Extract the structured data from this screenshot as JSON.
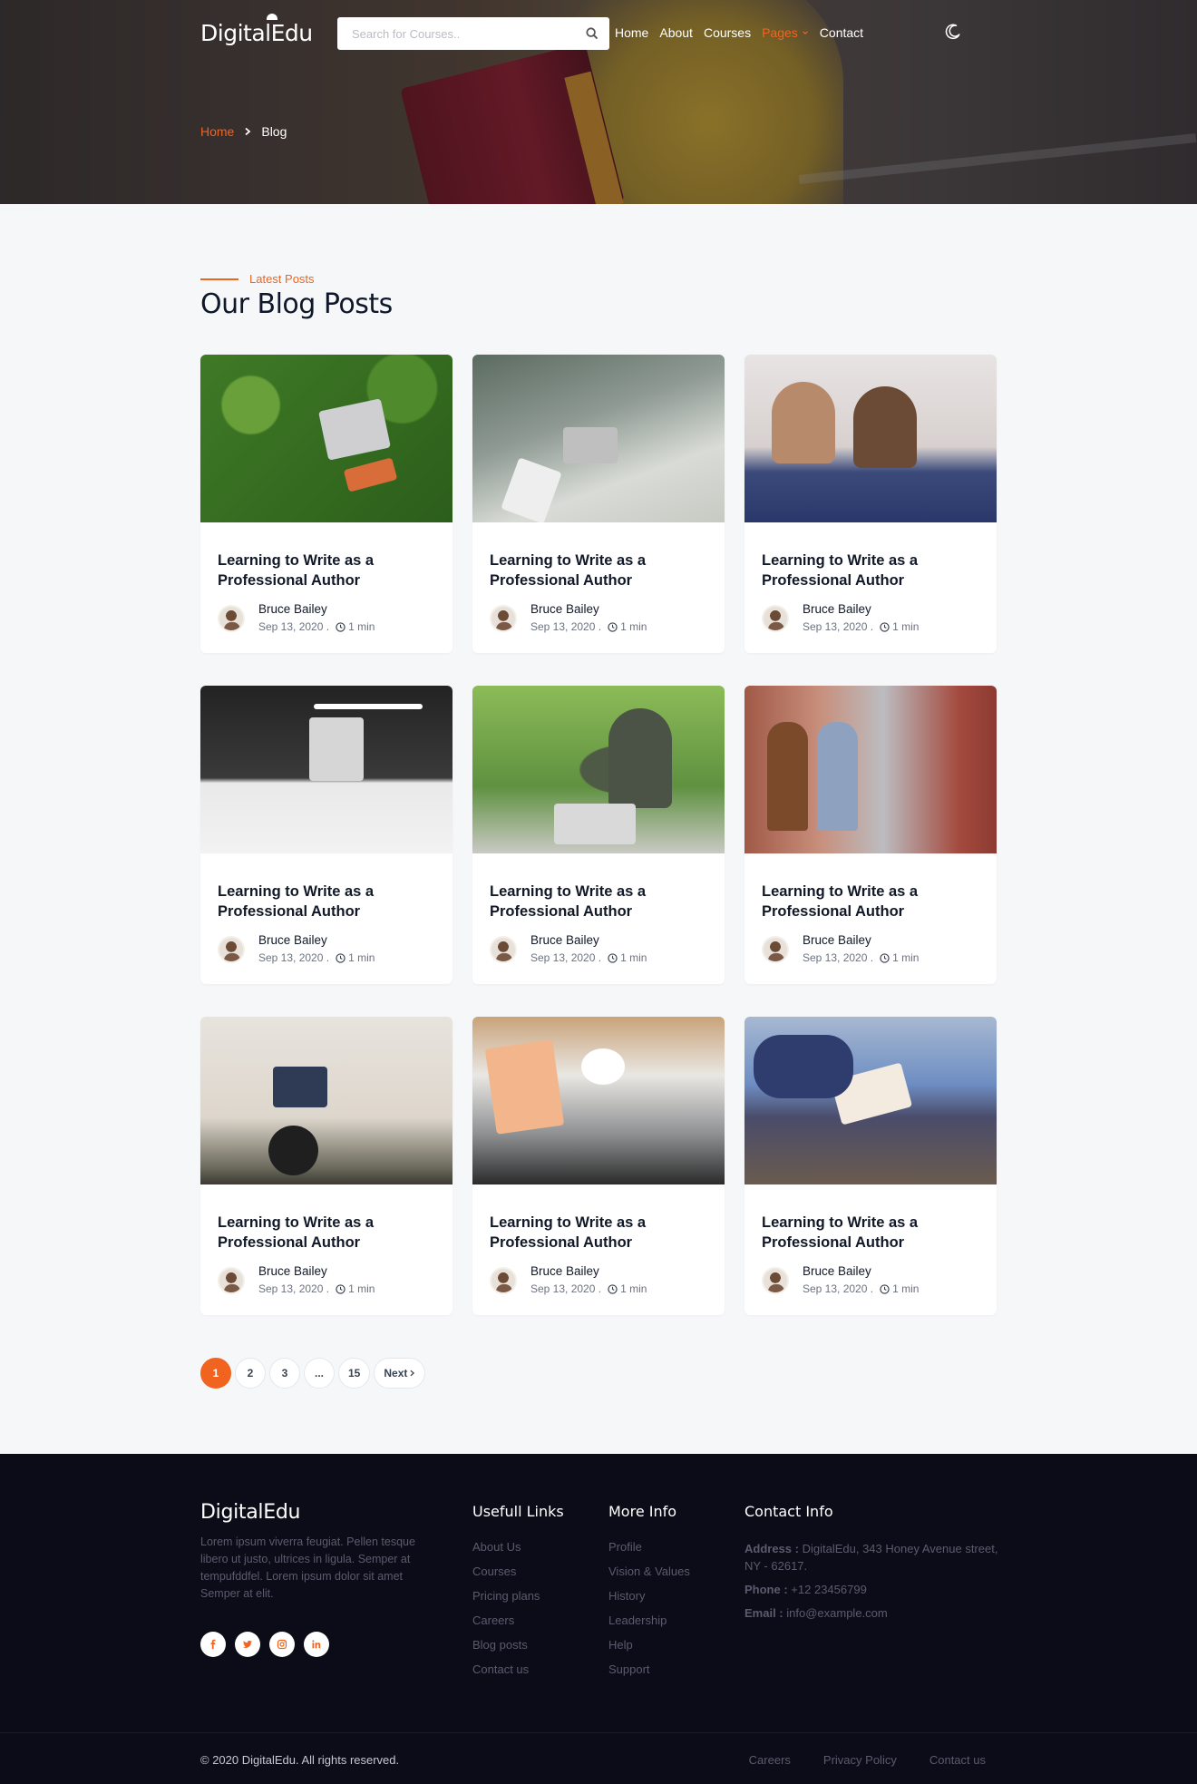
{
  "header": {
    "logo": "DigitalEdu",
    "search_placeholder": "Search for Courses..",
    "nav": [
      {
        "label": "Home",
        "active": false
      },
      {
        "label": "About",
        "active": false
      },
      {
        "label": "Courses",
        "active": false
      },
      {
        "label": "Pages",
        "active": true,
        "has_dropdown": true
      },
      {
        "label": "Contact",
        "active": false
      }
    ],
    "theme_toggle_icon": "moon-icon",
    "accent_color": "#f0641f"
  },
  "breadcrumb": {
    "home": "Home",
    "current": "Blog"
  },
  "section": {
    "kicker": "Latest Posts",
    "title": "Our Blog Posts"
  },
  "posts": [
    {
      "title": "Learning to Write as a Professional Author",
      "author": "Bruce Bailey",
      "date": "Sep 13, 2020 .",
      "read_time": "1 min"
    },
    {
      "title": "Learning to Write as a Professional Author",
      "author": "Bruce Bailey",
      "date": "Sep 13, 2020 .",
      "read_time": "1 min"
    },
    {
      "title": "Learning to Write as a Professional Author",
      "author": "Bruce Bailey",
      "date": "Sep 13, 2020 .",
      "read_time": "1 min"
    },
    {
      "title": "Learning to Write as a Professional Author",
      "author": "Bruce Bailey",
      "date": "Sep 13, 2020 .",
      "read_time": "1 min"
    },
    {
      "title": "Learning to Write as a Professional Author",
      "author": "Bruce Bailey",
      "date": "Sep 13, 2020 .",
      "read_time": "1 min"
    },
    {
      "title": "Learning to Write as a Professional Author",
      "author": "Bruce Bailey",
      "date": "Sep 13, 2020 .",
      "read_time": "1 min"
    },
    {
      "title": "Learning to Write as a Professional Author",
      "author": "Bruce Bailey",
      "date": "Sep 13, 2020 .",
      "read_time": "1 min"
    },
    {
      "title": "Learning to Write as a Professional Author",
      "author": "Bruce Bailey",
      "date": "Sep 13, 2020 .",
      "read_time": "1 min"
    },
    {
      "title": "Learning to Write as a Professional Author",
      "author": "Bruce Bailey",
      "date": "Sep 13, 2020 .",
      "read_time": "1 min"
    }
  ],
  "pagination": {
    "pages": [
      "1",
      "2",
      "3",
      "...",
      "15"
    ],
    "active": "1",
    "next": "Next"
  },
  "footer": {
    "logo": "DigitalEdu",
    "description": "Lorem ipsum viverra feugiat. Pellen tesque libero ut justo, ultrices in ligula. Semper at tempufddfel. Lorem ipsum dolor sit amet Semper at elit.",
    "socials": [
      "facebook-icon",
      "twitter-icon",
      "instagram-icon",
      "linkedin-icon"
    ],
    "useful_links": {
      "heading": "Usefull Links",
      "items": [
        "About Us",
        "Courses",
        "Pricing plans",
        "Careers",
        "Blog posts",
        "Contact us"
      ]
    },
    "more_info": {
      "heading": "More Info",
      "items": [
        "Profile",
        "Vision & Values",
        "History",
        "Leadership",
        "Help",
        "Support"
      ]
    },
    "contact": {
      "heading": "Contact Info",
      "address_label": "Address :",
      "address": "DigitalEdu, 343 Honey Avenue street, NY - 62617.",
      "phone_label": "Phone :",
      "phone": "+12 23456799",
      "email_label": "Email :",
      "email": "info@example.com"
    },
    "copyright": "© 2020 DigitalEdu. All rights reserved.",
    "bottom_links": [
      "Careers",
      "Privacy Policy",
      "Contact us"
    ]
  }
}
